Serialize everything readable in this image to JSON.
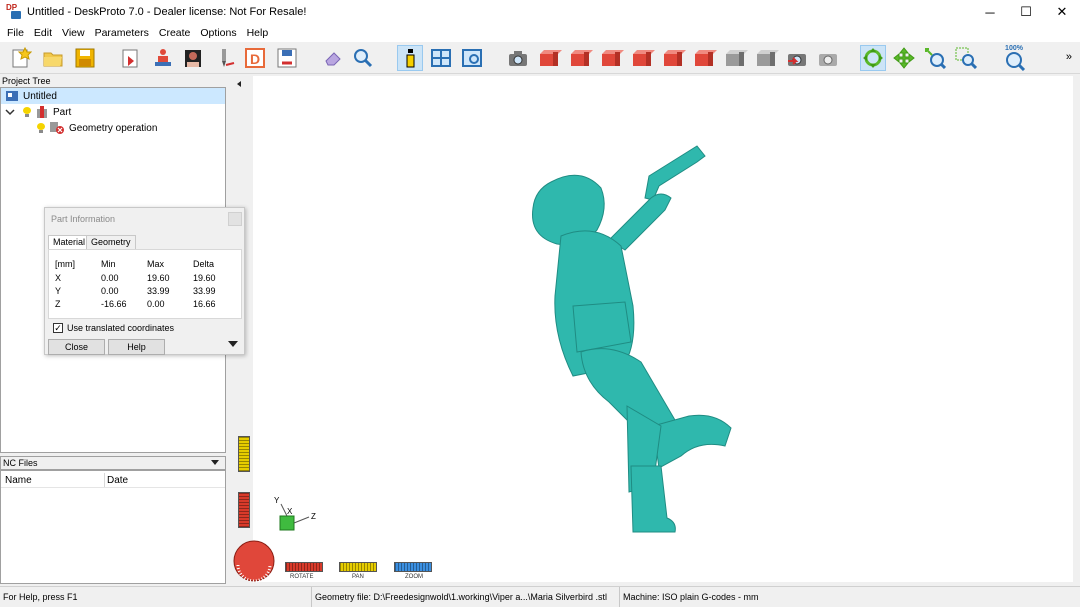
{
  "window": {
    "title": "Untitled - DeskProto 7.0 - Dealer license: Not For Resale!",
    "logo_text": "DP",
    "minimize_glyph": "─",
    "maximize_glyph": "☐",
    "close_glyph": "✕"
  },
  "menu": [
    "File",
    "Edit",
    "View",
    "Parameters",
    "Create",
    "Options",
    "Help"
  ],
  "toolbar": {
    "zoom_level": "100%",
    "more_glyph": "»"
  },
  "project_tree": {
    "header": "Project Tree",
    "root": "Untitled",
    "part": "Part",
    "operation": "Geometry operation"
  },
  "nc_files": {
    "header": "NC Files",
    "columns": [
      "Name",
      "Date"
    ]
  },
  "part_info": {
    "title": "Part Information",
    "tabs": [
      "Material",
      "Geometry"
    ],
    "headers": [
      "[mm]",
      "Min",
      "Max",
      "Delta"
    ],
    "rows": [
      [
        "X",
        "0.00",
        "19.60",
        "19.60"
      ],
      [
        "Y",
        "0.00",
        "33.99",
        "33.99"
      ],
      [
        "Z",
        "-16.66",
        "0.00",
        "16.66"
      ]
    ],
    "checkbox_label": "Use translated coordinates",
    "checkbox_checked": true,
    "close_label": "Close",
    "help_label": "Help"
  },
  "viewport": {
    "model_color": "#2fb8ad",
    "axis_labels": [
      "Y",
      "X",
      "Z"
    ],
    "slider_labels": [
      "ROTATE",
      "PAN",
      "ZOOM"
    ]
  },
  "status": {
    "help": "For Help, press F1",
    "geometry": "Geometry file: D:\\Freedesignwold\\1.working\\Viper a...\\Maria Silverbird .stl",
    "machine": "Machine: ISO plain G-codes - mm"
  }
}
